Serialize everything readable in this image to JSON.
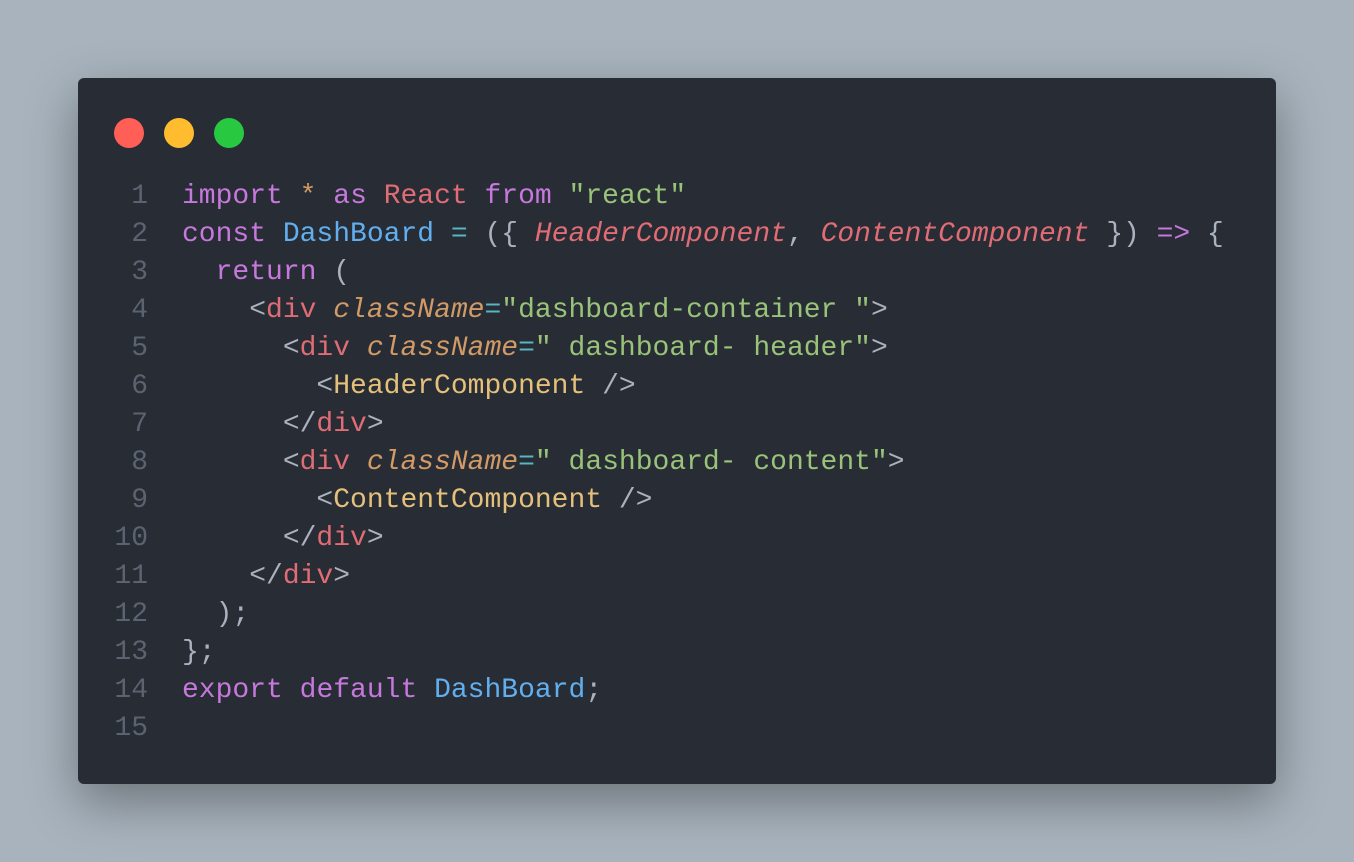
{
  "window": {
    "controls": [
      {
        "name": "close",
        "color": "#ff5f57"
      },
      {
        "name": "minimize",
        "color": "#febc2e"
      },
      {
        "name": "maximize",
        "color": "#28c840"
      }
    ]
  },
  "colors": {
    "keyword": "#c678dd",
    "operator": "#56b6c2",
    "variable": "#e06c75",
    "string": "#98c379",
    "function": "#61afef",
    "component": "#e5c07b",
    "attribute": "#d19a66",
    "punctuation": "#abb2bf",
    "line_number": "#5c6370"
  },
  "code": {
    "language": "jsx",
    "lines": [
      {
        "number": "1",
        "tokens": [
          {
            "text": "import",
            "type": "keyword"
          },
          {
            "text": " ",
            "type": "punctuation"
          },
          {
            "text": "*",
            "type": "attribute"
          },
          {
            "text": " ",
            "type": "punctuation"
          },
          {
            "text": "as",
            "type": "keyword"
          },
          {
            "text": " ",
            "type": "punctuation"
          },
          {
            "text": "React",
            "type": "variable"
          },
          {
            "text": " ",
            "type": "punctuation"
          },
          {
            "text": "from",
            "type": "keyword"
          },
          {
            "text": " ",
            "type": "punctuation"
          },
          {
            "text": "\"react\"",
            "type": "string"
          }
        ]
      },
      {
        "number": "2",
        "tokens": [
          {
            "text": "const",
            "type": "keyword"
          },
          {
            "text": " ",
            "type": "punctuation"
          },
          {
            "text": "DashBoard",
            "type": "function"
          },
          {
            "text": " ",
            "type": "punctuation"
          },
          {
            "text": "=",
            "type": "operator"
          },
          {
            "text": " ({ ",
            "type": "punctuation"
          },
          {
            "text": "HeaderComponent",
            "type": "variable",
            "italic": true
          },
          {
            "text": ", ",
            "type": "punctuation"
          },
          {
            "text": "ContentComponent",
            "type": "variable",
            "italic": true
          },
          {
            "text": " }) ",
            "type": "punctuation"
          },
          {
            "text": "=>",
            "type": "keyword"
          },
          {
            "text": " {",
            "type": "punctuation"
          }
        ]
      },
      {
        "number": "3",
        "tokens": [
          {
            "text": "  ",
            "type": "punctuation"
          },
          {
            "text": "return",
            "type": "keyword"
          },
          {
            "text": " (",
            "type": "punctuation"
          }
        ]
      },
      {
        "number": "4",
        "tokens": [
          {
            "text": "    <",
            "type": "punctuation"
          },
          {
            "text": "div",
            "type": "variable"
          },
          {
            "text": " ",
            "type": "punctuation"
          },
          {
            "text": "className",
            "type": "attribute",
            "italic": true
          },
          {
            "text": "=",
            "type": "operator"
          },
          {
            "text": "\"dashboard-container \"",
            "type": "string"
          },
          {
            "text": ">",
            "type": "punctuation"
          }
        ]
      },
      {
        "number": "5",
        "tokens": [
          {
            "text": "      <",
            "type": "punctuation"
          },
          {
            "text": "div",
            "type": "variable"
          },
          {
            "text": " ",
            "type": "punctuation"
          },
          {
            "text": "className",
            "type": "attribute",
            "italic": true
          },
          {
            "text": "=",
            "type": "operator"
          },
          {
            "text": "\" dashboard- header\"",
            "type": "string"
          },
          {
            "text": ">",
            "type": "punctuation"
          }
        ]
      },
      {
        "number": "6",
        "tokens": [
          {
            "text": "        <",
            "type": "punctuation"
          },
          {
            "text": "HeaderComponent",
            "type": "component"
          },
          {
            "text": " />",
            "type": "punctuation"
          }
        ]
      },
      {
        "number": "7",
        "tokens": [
          {
            "text": "      </",
            "type": "punctuation"
          },
          {
            "text": "div",
            "type": "variable"
          },
          {
            "text": ">",
            "type": "punctuation"
          }
        ]
      },
      {
        "number": "8",
        "tokens": [
          {
            "text": "      <",
            "type": "punctuation"
          },
          {
            "text": "div",
            "type": "variable"
          },
          {
            "text": " ",
            "type": "punctuation"
          },
          {
            "text": "className",
            "type": "attribute",
            "italic": true
          },
          {
            "text": "=",
            "type": "operator"
          },
          {
            "text": "\" dashboard- content\"",
            "type": "string"
          },
          {
            "text": ">",
            "type": "punctuation"
          }
        ]
      },
      {
        "number": "9",
        "tokens": [
          {
            "text": "        <",
            "type": "punctuation"
          },
          {
            "text": "ContentComponent",
            "type": "component"
          },
          {
            "text": " />",
            "type": "punctuation"
          }
        ]
      },
      {
        "number": "10",
        "tokens": [
          {
            "text": "      </",
            "type": "punctuation"
          },
          {
            "text": "div",
            "type": "variable"
          },
          {
            "text": ">",
            "type": "punctuation"
          }
        ]
      },
      {
        "number": "11",
        "tokens": [
          {
            "text": "    </",
            "type": "punctuation"
          },
          {
            "text": "div",
            "type": "variable"
          },
          {
            "text": ">",
            "type": "punctuation"
          }
        ]
      },
      {
        "number": "12",
        "tokens": [
          {
            "text": "  );",
            "type": "punctuation"
          }
        ]
      },
      {
        "number": "13",
        "tokens": [
          {
            "text": "};",
            "type": "punctuation"
          }
        ]
      },
      {
        "number": "14",
        "tokens": [
          {
            "text": "export",
            "type": "keyword"
          },
          {
            "text": " ",
            "type": "punctuation"
          },
          {
            "text": "default",
            "type": "keyword"
          },
          {
            "text": " ",
            "type": "punctuation"
          },
          {
            "text": "DashBoard",
            "type": "function"
          },
          {
            "text": ";",
            "type": "punctuation"
          }
        ]
      },
      {
        "number": "15",
        "tokens": []
      }
    ]
  }
}
